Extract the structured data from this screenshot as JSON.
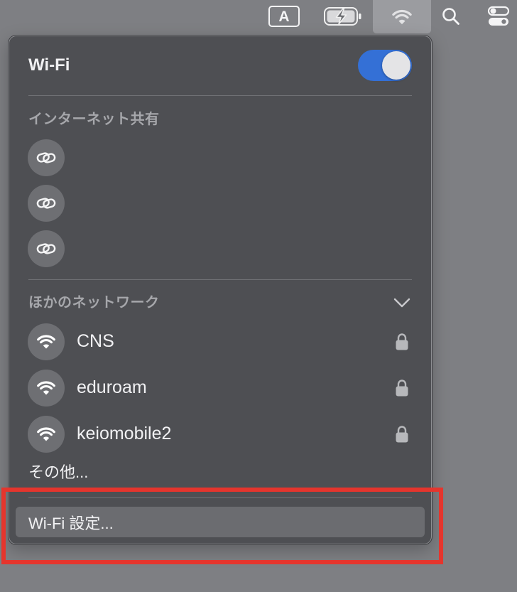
{
  "menubar": {
    "input_source": "A",
    "icons": {
      "input_source": "input-source-icon",
      "battery": "battery-charging-icon",
      "wifi": "wifi-icon",
      "search": "search-icon",
      "control_center": "control-center-icon"
    },
    "active_item": "wifi"
  },
  "wifi": {
    "title": "Wi-Fi",
    "enabled": true
  },
  "hotspot": {
    "header": "インターネット共有",
    "items": [
      {
        "icon": "link-icon"
      },
      {
        "icon": "link-icon"
      },
      {
        "icon": "link-icon"
      }
    ]
  },
  "other_networks": {
    "header": "ほかのネットワーク",
    "expanded": true,
    "networks": [
      {
        "name": "CNS",
        "icon": "wifi-icon",
        "secured": true
      },
      {
        "name": "eduroam",
        "icon": "wifi-icon",
        "secured": true
      },
      {
        "name": "keiomobile2",
        "icon": "wifi-icon",
        "secured": true
      }
    ]
  },
  "other_item": "その他...",
  "settings": {
    "label": "Wi-Fi 設定...",
    "highlighted": true
  },
  "annotation": {
    "color": "#e5352d"
  },
  "colors": {
    "desktop": "#7e7f83",
    "panel": "#4e4f53",
    "toggle_on": "#3470d6",
    "row_highlight": "#6b6c70",
    "menubar_highlight": "#9b9ca0"
  }
}
